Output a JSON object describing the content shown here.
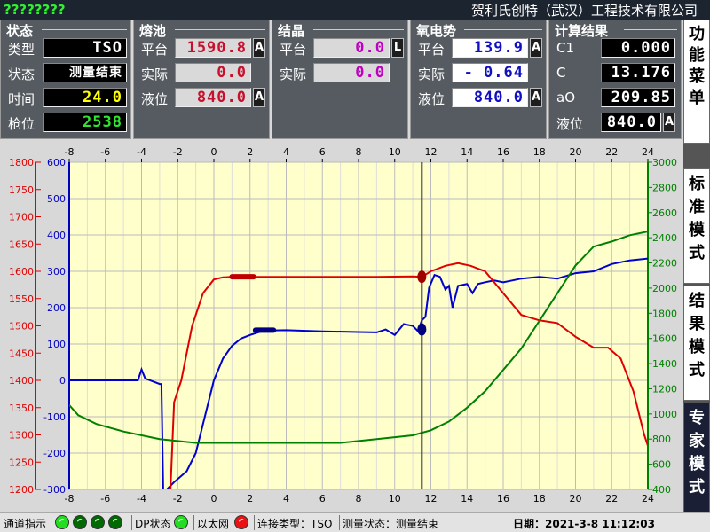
{
  "titlebar": {
    "left": "????????",
    "company": "贺利氏创特（武汉）工程技术有限公司"
  },
  "status": {
    "title": "状态",
    "rows": [
      {
        "label": "类型",
        "value": "TSO",
        "color": "#ffffff"
      },
      {
        "label": "状态",
        "value": "测量结束",
        "color": "#ffffff"
      },
      {
        "label": "时间",
        "value": "24.0",
        "color": "#ffff00"
      },
      {
        "label": "枪位",
        "value": "2538",
        "color": "#31e631"
      }
    ]
  },
  "bath": {
    "title": "熔池",
    "rows": [
      {
        "label": "平台",
        "value": "1590.8",
        "unit": "A"
      },
      {
        "label": "实际",
        "value": "0.0",
        "unit": ""
      },
      {
        "label": "液位",
        "value": "840.0",
        "unit": "A"
      }
    ],
    "color": "#c8102e"
  },
  "cryst": {
    "title": "结晶",
    "rows": [
      {
        "label": "平台",
        "value": "0.0",
        "unit": "L"
      },
      {
        "label": "实际",
        "value": "0.0",
        "unit": ""
      }
    ],
    "color": "#c000c0"
  },
  "emf": {
    "title": "氧电势",
    "rows": [
      {
        "label": "平台",
        "value": "139.9",
        "unit": "A"
      },
      {
        "label": "实际",
        "value": "- 0.64",
        "unit": ""
      },
      {
        "label": "液位",
        "value": "840.0",
        "unit": "A"
      }
    ],
    "color": "#1010c0"
  },
  "calc": {
    "title": "计算结果",
    "rows": [
      {
        "label": "C1",
        "value": "0.000",
        "unit": ""
      },
      {
        "label": "C",
        "value": "13.176",
        "unit": ""
      },
      {
        "label": "aO",
        "value": "209.85",
        "unit": ""
      },
      {
        "label": "液位",
        "value": "840.0",
        "unit": "A"
      }
    ]
  },
  "side_menu": [
    {
      "label": "功能菜单",
      "active": false
    },
    {
      "label": "标准模式",
      "active": false
    },
    {
      "label": "结果模式",
      "active": false
    },
    {
      "label": "专家模式",
      "active": true
    }
  ],
  "statusbar": {
    "channel_label": "通道指示",
    "dp_label": "DP状态",
    "eth_label": "以太网",
    "conn_label": "连接类型：TSO",
    "meas_label": "测量状态：测量结束",
    "date_label": "日期：2021-3-8  11:12:03"
  },
  "chart_data": {
    "type": "line",
    "x_ticks": [
      -8,
      -6,
      -4,
      -2,
      0,
      2,
      4,
      6,
      8,
      10,
      12,
      14,
      16,
      18,
      20,
      22,
      24
    ],
    "xlim": [
      -8,
      24
    ],
    "axes": {
      "temp": {
        "range": [
          1200,
          1800
        ],
        "ticks": [
          1800,
          1750,
          1700,
          1650,
          1600,
          1550,
          1500,
          1450,
          1400,
          1350,
          1300,
          1250,
          1200
        ],
        "color": "#e00000"
      },
      "emf": {
        "range": [
          -300,
          600
        ],
        "ticks": [
          600,
          500,
          400,
          300,
          200,
          100,
          0,
          -100,
          -200,
          -300
        ],
        "color": "#0000c0"
      },
      "level": {
        "range": [
          400,
          3000
        ],
        "ticks": [
          3000,
          2800,
          2600,
          2400,
          2200,
          2000,
          1800,
          1600,
          1400,
          1200,
          1000,
          800,
          600,
          400
        ],
        "color": "#008000"
      }
    },
    "cursor_x": 11.5,
    "series": [
      {
        "axis": "emf",
        "color": "#0000d0",
        "points": [
          [
            -8,
            0
          ],
          [
            -5.5,
            0
          ],
          [
            -4.2,
            0
          ],
          [
            -4,
            30
          ],
          [
            -3.8,
            5
          ],
          [
            -3,
            -10
          ],
          [
            -2.9,
            -10
          ],
          [
            -2.8,
            -300
          ],
          [
            -2.6,
            -300
          ],
          [
            -2.2,
            -280
          ],
          [
            -1.5,
            -250
          ],
          [
            -1,
            -200
          ],
          [
            -0.5,
            -100
          ],
          [
            0,
            0
          ],
          [
            0.5,
            60
          ],
          [
            1,
            95
          ],
          [
            1.5,
            115
          ],
          [
            2,
            125
          ],
          [
            2.5,
            133
          ],
          [
            3,
            137
          ],
          [
            4,
            138
          ],
          [
            6,
            135
          ],
          [
            8,
            133
          ],
          [
            9,
            132
          ],
          [
            9.5,
            140
          ],
          [
            10,
            125
          ],
          [
            10.5,
            155
          ],
          [
            11,
            150
          ],
          [
            11.3,
            135
          ],
          [
            11.5,
            165
          ],
          [
            11.7,
            175
          ],
          [
            11.9,
            255
          ],
          [
            12.2,
            290
          ],
          [
            12.5,
            285
          ],
          [
            12.8,
            250
          ],
          [
            13,
            260
          ],
          [
            13.2,
            200
          ],
          [
            13.5,
            260
          ],
          [
            14,
            265
          ],
          [
            14.3,
            240
          ],
          [
            14.6,
            265
          ],
          [
            15,
            270
          ],
          [
            15.5,
            275
          ],
          [
            16,
            270
          ],
          [
            16.5,
            275
          ],
          [
            17,
            280
          ],
          [
            18,
            285
          ],
          [
            19,
            280
          ],
          [
            20,
            295
          ],
          [
            21,
            300
          ],
          [
            22,
            320
          ],
          [
            23,
            330
          ],
          [
            24,
            335
          ]
        ]
      },
      {
        "axis": "temp",
        "color": "#e00000",
        "points": [
          [
            -2.4,
            1200
          ],
          [
            -2.2,
            1360
          ],
          [
            -1.8,
            1400
          ],
          [
            -1.2,
            1500
          ],
          [
            -0.6,
            1560
          ],
          [
            0,
            1585
          ],
          [
            0.5,
            1589
          ],
          [
            1,
            1590
          ],
          [
            3,
            1590
          ],
          [
            6,
            1590
          ],
          [
            9,
            1590
          ],
          [
            11,
            1590.8
          ],
          [
            11.5,
            1590
          ],
          [
            12,
            1600
          ],
          [
            12.8,
            1610
          ],
          [
            13.5,
            1615
          ],
          [
            14.2,
            1610
          ],
          [
            15,
            1600
          ],
          [
            16,
            1560
          ],
          [
            17,
            1520
          ],
          [
            18,
            1510
          ],
          [
            19,
            1505
          ],
          [
            20,
            1480
          ],
          [
            21,
            1460
          ],
          [
            21.8,
            1460
          ],
          [
            22.5,
            1440
          ],
          [
            23.2,
            1380
          ],
          [
            23.8,
            1300
          ],
          [
            24,
            1280
          ]
        ]
      },
      {
        "axis": "level",
        "color": "#008000",
        "points": [
          [
            -8,
            1070
          ],
          [
            -7.5,
            990
          ],
          [
            -6.5,
            920
          ],
          [
            -5,
            860
          ],
          [
            -3,
            800
          ],
          [
            -1,
            770
          ],
          [
            2,
            770
          ],
          [
            5,
            770
          ],
          [
            7,
            770
          ],
          [
            8,
            785
          ],
          [
            9,
            800
          ],
          [
            10,
            815
          ],
          [
            11,
            830
          ],
          [
            12,
            870
          ],
          [
            13,
            940
          ],
          [
            14,
            1050
          ],
          [
            15,
            1180
          ],
          [
            16,
            1350
          ],
          [
            17,
            1520
          ],
          [
            18,
            1740
          ],
          [
            19,
            1960
          ],
          [
            20,
            2180
          ],
          [
            21,
            2330
          ],
          [
            22,
            2370
          ],
          [
            23,
            2420
          ],
          [
            24,
            2450
          ]
        ]
      }
    ],
    "markers": [
      {
        "axis": "temp",
        "x1": 1,
        "x2": 2.2,
        "y": 1590,
        "color": "#c00000"
      },
      {
        "axis": "emf",
        "x1": 2.3,
        "x2": 3.3,
        "y": 138,
        "color": "#000080"
      },
      {
        "axis": "temp",
        "x": 11.5,
        "y": 1590,
        "color": "#a00000",
        "dot": true
      },
      {
        "axis": "emf",
        "x": 11.5,
        "y": 140,
        "color": "#000080",
        "dot": true
      }
    ]
  }
}
